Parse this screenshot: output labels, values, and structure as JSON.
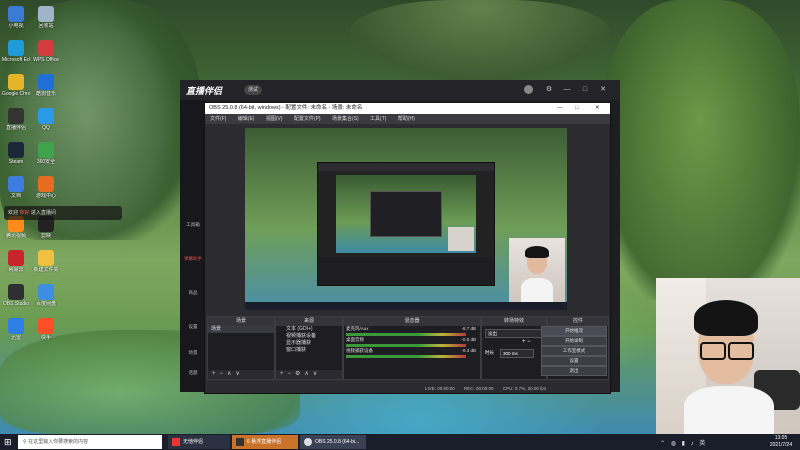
{
  "desktop": {
    "icons": [
      {
        "label": "小电视",
        "color": "#3b7bd6"
      },
      {
        "label": "回收站",
        "color": "#9fb4c8"
      },
      {
        "label": "Microsoft Edge",
        "color": "#1e9bd8"
      },
      {
        "label": "WPS Office",
        "color": "#d23c3c"
      },
      {
        "label": "Google Chrome",
        "color": "#e4b429"
      },
      {
        "label": "酷狗音乐",
        "color": "#1f6fd9"
      },
      {
        "label": "直播伴侣",
        "color": "#333333"
      },
      {
        "label": "QQ",
        "color": "#2b9ae6"
      },
      {
        "label": "Steam",
        "color": "#1b2838"
      },
      {
        "label": "360安全",
        "color": "#3fa34d"
      },
      {
        "label": "文档",
        "color": "#3d7de0"
      },
      {
        "label": "游戏中心",
        "color": "#e66c1f"
      },
      {
        "label": "腾讯视频",
        "color": "#ff8c1a"
      },
      {
        "label": "剪映",
        "color": "#222222"
      },
      {
        "label": "网易云",
        "color": "#c8242b"
      },
      {
        "label": "新建文件夹",
        "color": "#f0c040"
      },
      {
        "label": "OBS Studio",
        "color": "#2e2e33"
      },
      {
        "label": "百度网盘",
        "color": "#3e8de3"
      },
      {
        "label": "迅雷",
        "color": "#2d7ee6"
      },
      {
        "label": "快手",
        "color": "#ff4f2a"
      }
    ],
    "notification": {
      "prefix": "欢迎",
      "highlight": "你好",
      "suffix": "进入直播间"
    }
  },
  "helper_window": {
    "logo": "直播伴侣",
    "version": "测试",
    "side_items": [
      "工具箱",
      "弹幕助手",
      "商品",
      "设置",
      "场景",
      "话题"
    ]
  },
  "obs": {
    "title": "OBS 25.0.8 (64-bit, windows) - 配置文件: 未命名 - 场景: 未命名",
    "menu": [
      "文件(F)",
      "编辑(E)",
      "视图(V)",
      "配置文件(P)",
      "场景集合(S)",
      "工具(T)",
      "帮助(H)"
    ],
    "panels": {
      "scenes": {
        "title": "场景",
        "items": [
          "场景"
        ]
      },
      "sources": {
        "title": "来源",
        "items": [
          "文本 (GDI+)",
          "视频捕获设备",
          "显示器捕获",
          "窗口捕获"
        ]
      },
      "mixer": {
        "title": "混音器",
        "channels": [
          {
            "name": "麦克风/Aux",
            "db": "-8.7 dB"
          },
          {
            "name": "桌面音频",
            "db": "-0.0 dB"
          },
          {
            "name": "视频捕获设备",
            "db": "-9.3 dB"
          }
        ]
      },
      "transitions": {
        "title": "转场特效",
        "type": "淡出",
        "duration_label": "时长",
        "duration_value": "300 ms"
      },
      "controls": {
        "title": "控件",
        "buttons": [
          "开始推流",
          "开始录制",
          "工作室模式",
          "设置",
          "退出"
        ]
      }
    },
    "status": {
      "live": "LIVE: 00:00:00",
      "rec": "REC: 00:00:00",
      "cpu": "CPU: 0.7%, 30.00 fps"
    }
  },
  "taskbar": {
    "search_placeholder": "在这里输入你要搜索的内容",
    "apps": [
      "无他伴侣",
      "6 悬浮直播伴侣",
      "OBS 25.0.8 (64-bi..."
    ],
    "time": "13:05",
    "date": "2021/7/24"
  }
}
